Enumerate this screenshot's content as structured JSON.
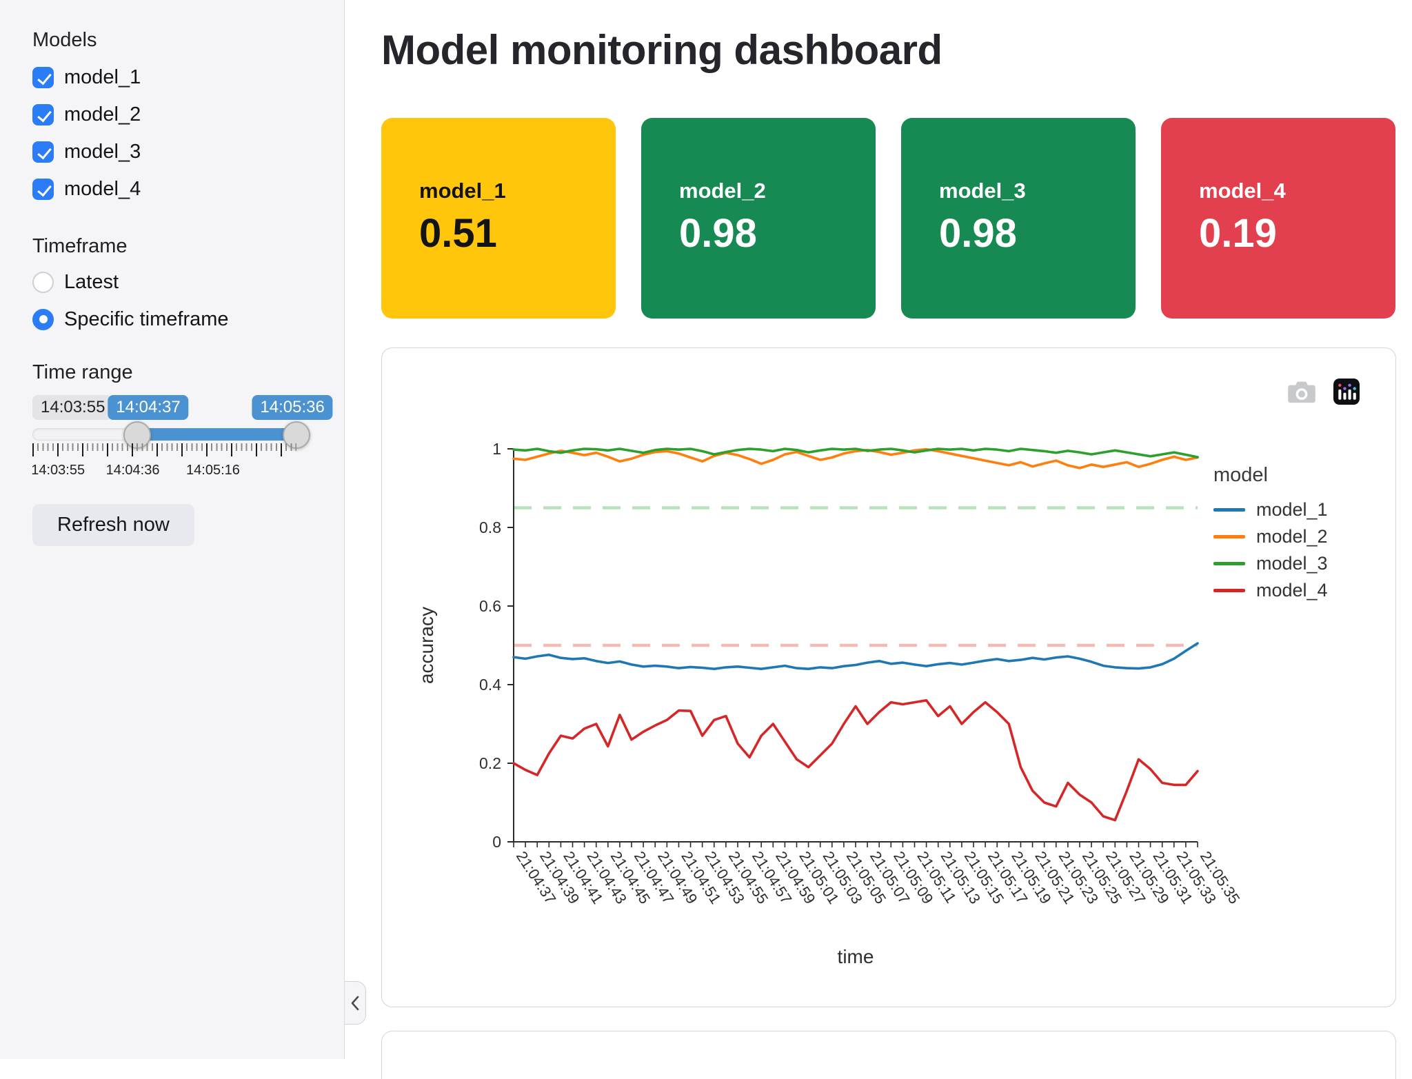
{
  "sidebar": {
    "models_label": "Models",
    "models": [
      {
        "label": "model_1",
        "checked": true
      },
      {
        "label": "model_2",
        "checked": true
      },
      {
        "label": "model_3",
        "checked": true
      },
      {
        "label": "model_4",
        "checked": true
      }
    ],
    "timeframe_label": "Timeframe",
    "timeframe_options": [
      {
        "label": "Latest",
        "selected": false
      },
      {
        "label": "Specific timeframe",
        "selected": true
      }
    ],
    "time_range_label": "Time range",
    "slider": {
      "min_readout": "14:03:55",
      "lower_value": "14:04:37",
      "upper_value": "14:05:36",
      "axis_ticks": [
        "14:03:55",
        "14:04:36",
        "14:05:16"
      ]
    },
    "refresh_button_label": "Refresh now"
  },
  "header": {
    "title": "Model monitoring dashboard"
  },
  "metric_cards": [
    {
      "label": "model_1",
      "value": "0.51",
      "bg": "#ffc60b",
      "text": "#141414"
    },
    {
      "label": "model_2",
      "value": "0.98",
      "bg": "#178a53",
      "text": "#ffffff"
    },
    {
      "label": "model_3",
      "value": "0.98",
      "bg": "#178a53",
      "text": "#ffffff"
    },
    {
      "label": "model_4",
      "value": "0.19",
      "bg": "#e2404f",
      "text": "#ffffff"
    }
  ],
  "chart_data": {
    "type": "line",
    "xlabel": "time",
    "ylabel": "accuracy",
    "legend_title": "model",
    "legend_position": "right",
    "grid": false,
    "ylim": [
      0,
      1
    ],
    "y_ticks": [
      0,
      0.2,
      0.4,
      0.6,
      0.8,
      1
    ],
    "points_per_tick_label": 2,
    "x_tick_labels": [
      "21:04:37",
      "21:04:39",
      "21:04:41",
      "21:04:43",
      "21:04:45",
      "21:04:47",
      "21:04:49",
      "21:04:51",
      "21:04:53",
      "21:04:55",
      "21:04:57",
      "21:04:59",
      "21:05:01",
      "21:05:03",
      "21:05:05",
      "21:05:07",
      "21:05:09",
      "21:05:11",
      "21:05:13",
      "21:05:15",
      "21:05:17",
      "21:05:19",
      "21:05:21",
      "21:05:23",
      "21:05:25",
      "21:05:27",
      "21:05:29",
      "21:05:31",
      "21:05:33",
      "21:05:35"
    ],
    "thresholds": [
      {
        "y": 0.85,
        "color": "#b7e2ba"
      },
      {
        "y": 0.5,
        "color": "#f4bab6"
      }
    ],
    "series": [
      {
        "name": "model_1",
        "color": "#1f77b4",
        "values": [
          0.47,
          0.466,
          0.472,
          0.476,
          0.468,
          0.465,
          0.467,
          0.46,
          0.455,
          0.459,
          0.451,
          0.446,
          0.448,
          0.446,
          0.442,
          0.445,
          0.443,
          0.44,
          0.444,
          0.446,
          0.443,
          0.44,
          0.444,
          0.448,
          0.442,
          0.44,
          0.444,
          0.442,
          0.447,
          0.45,
          0.456,
          0.46,
          0.453,
          0.456,
          0.451,
          0.447,
          0.452,
          0.455,
          0.451,
          0.456,
          0.461,
          0.465,
          0.46,
          0.463,
          0.468,
          0.464,
          0.469,
          0.472,
          0.466,
          0.458,
          0.448,
          0.444,
          0.442,
          0.441,
          0.444,
          0.452,
          0.466,
          0.486,
          0.505
        ]
      },
      {
        "name": "model_2",
        "color": "#ff7f0e",
        "values": [
          0.975,
          0.972,
          0.98,
          0.988,
          0.995,
          0.99,
          0.984,
          0.99,
          0.98,
          0.968,
          0.975,
          0.985,
          0.992,
          0.994,
          0.988,
          0.978,
          0.968,
          0.982,
          0.99,
          0.984,
          0.974,
          0.962,
          0.972,
          0.986,
          0.992,
          0.982,
          0.972,
          0.978,
          0.988,
          0.994,
          0.997,
          0.992,
          0.985,
          0.99,
          0.996,
          0.999,
          0.994,
          0.988,
          0.982,
          0.976,
          0.97,
          0.964,
          0.958,
          0.966,
          0.955,
          0.963,
          0.97,
          0.958,
          0.951,
          0.96,
          0.954,
          0.96,
          0.966,
          0.954,
          0.962,
          0.972,
          0.98,
          0.972,
          0.978
        ]
      },
      {
        "name": "model_3",
        "color": "#2ca02c",
        "values": [
          0.998,
          0.996,
          1.0,
          0.994,
          0.99,
          0.996,
          1.0,
          0.999,
          0.996,
          1.0,
          0.995,
          0.99,
          0.997,
          1.0,
          0.998,
          1.0,
          0.994,
          0.986,
          0.992,
          0.997,
          1.0,
          0.998,
          0.994,
          1.0,
          0.997,
          0.991,
          0.996,
          1.0,
          0.998,
          1.0,
          0.995,
          0.998,
          1.0,
          0.996,
          0.991,
          0.996,
          1.0,
          0.998,
          1.0,
          0.996,
          1.0,
          0.998,
          0.994,
          1.0,
          0.997,
          0.994,
          0.99,
          0.995,
          0.991,
          0.986,
          0.991,
          0.996,
          0.991,
          0.986,
          0.981,
          0.986,
          0.991,
          0.985,
          0.979
        ]
      },
      {
        "name": "model_4",
        "color": "#d62728",
        "values": [
          0.2,
          0.183,
          0.17,
          0.225,
          0.27,
          0.263,
          0.288,
          0.3,
          0.243,
          0.323,
          0.26,
          0.28,
          0.296,
          0.31,
          0.334,
          0.333,
          0.27,
          0.31,
          0.32,
          0.25,
          0.215,
          0.27,
          0.3,
          0.255,
          0.21,
          0.19,
          0.22,
          0.25,
          0.3,
          0.345,
          0.3,
          0.33,
          0.355,
          0.35,
          0.355,
          0.36,
          0.32,
          0.345,
          0.3,
          0.33,
          0.355,
          0.33,
          0.3,
          0.19,
          0.13,
          0.1,
          0.09,
          0.15,
          0.12,
          0.1,
          0.065,
          0.055,
          0.13,
          0.21,
          0.185,
          0.15,
          0.145,
          0.145,
          0.18
        ]
      }
    ],
    "modebar_icons": [
      "camera-icon",
      "plotly-logo-icon"
    ]
  }
}
